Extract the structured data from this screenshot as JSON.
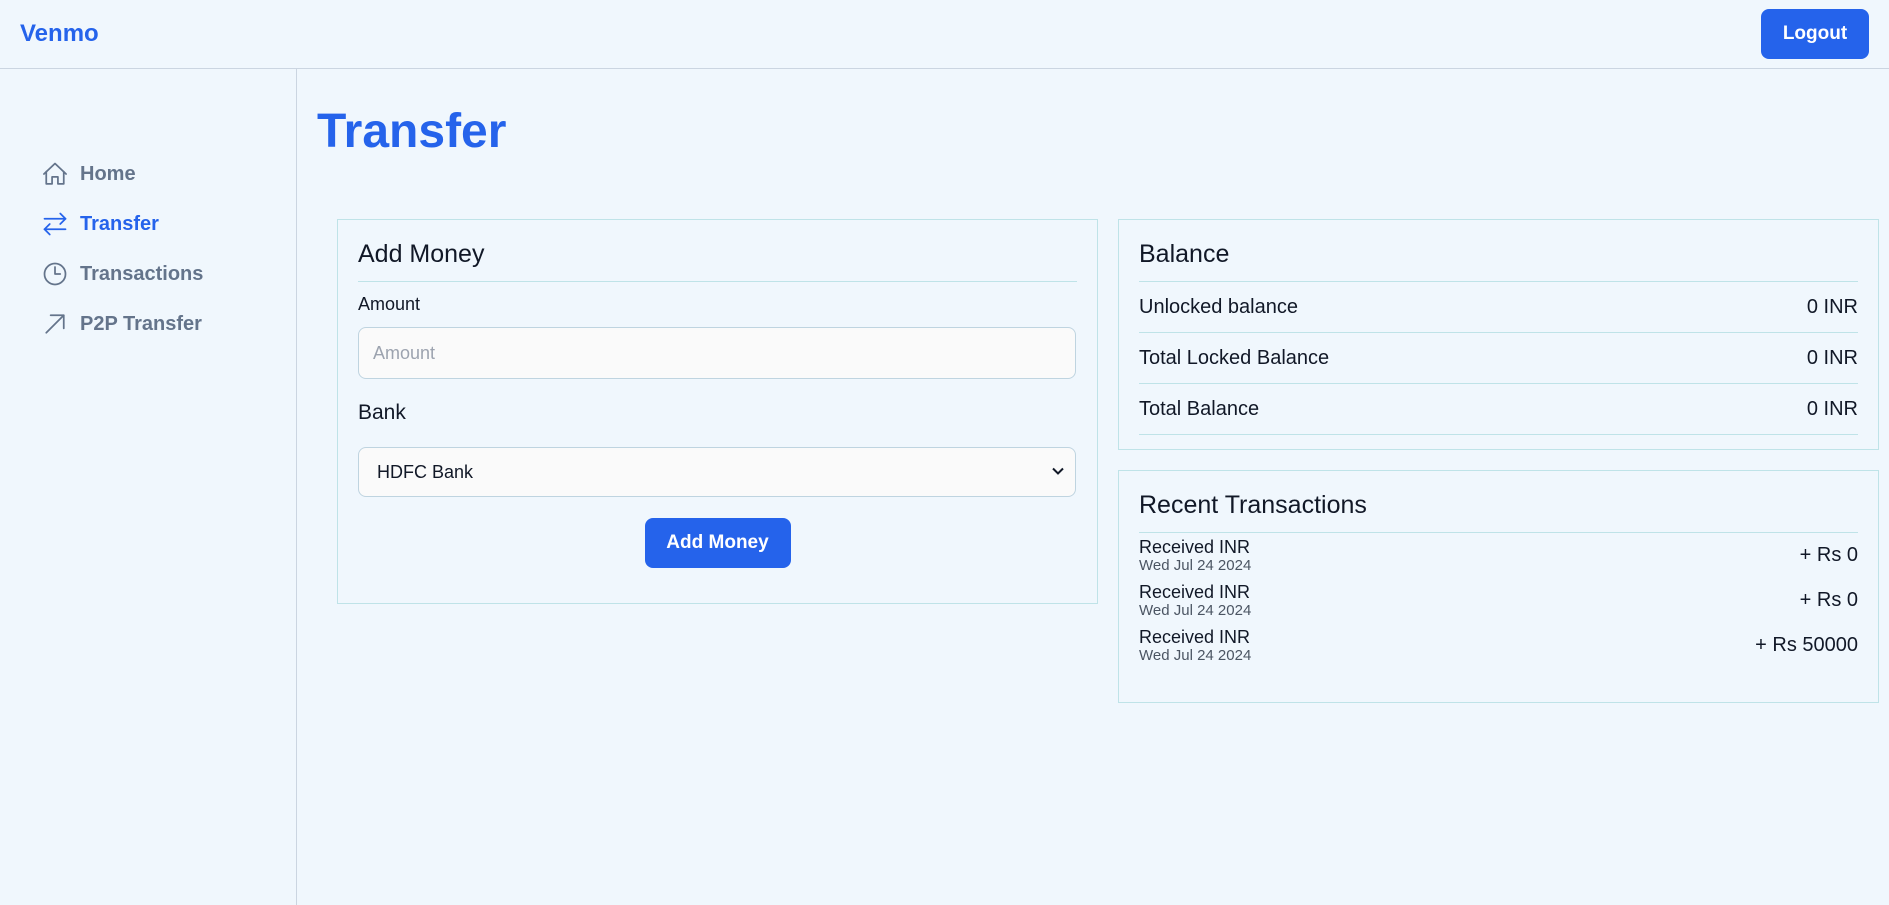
{
  "app": {
    "brand": "Venmo",
    "logout_label": "Logout"
  },
  "sidebar": {
    "items": [
      {
        "label": "Home",
        "icon": "home-icon",
        "active": false
      },
      {
        "label": "Transfer",
        "icon": "transfer-arrows-icon",
        "active": true
      },
      {
        "label": "Transactions",
        "icon": "clock-icon",
        "active": false
      },
      {
        "label": "P2P Transfer",
        "icon": "arrow-up-right-icon",
        "active": false
      }
    ]
  },
  "page": {
    "title": "Transfer"
  },
  "add_money": {
    "title": "Add Money",
    "amount_label": "Amount",
    "amount_placeholder": "Amount",
    "amount_value": "",
    "bank_label": "Bank",
    "bank_selected": "HDFC Bank",
    "submit_label": "Add Money"
  },
  "balance": {
    "title": "Balance",
    "rows": [
      {
        "label": "Unlocked balance",
        "value": "0 INR"
      },
      {
        "label": "Total Locked Balance",
        "value": "0 INR"
      },
      {
        "label": "Total Balance",
        "value": "0 INR"
      }
    ]
  },
  "recent": {
    "title": "Recent Transactions",
    "items": [
      {
        "title": "Received INR",
        "date": "Wed Jul 24 2024",
        "amount": "+ Rs 0"
      },
      {
        "title": "Received INR",
        "date": "Wed Jul 24 2024",
        "amount": "+ Rs 0"
      },
      {
        "title": "Received INR",
        "date": "Wed Jul 24 2024",
        "amount": "+ Rs 50000"
      }
    ]
  },
  "colors": {
    "accent": "#2563eb",
    "background": "#f0f7fd",
    "muted_nav": "#64748b",
    "card_border": "#bfe3e8"
  }
}
